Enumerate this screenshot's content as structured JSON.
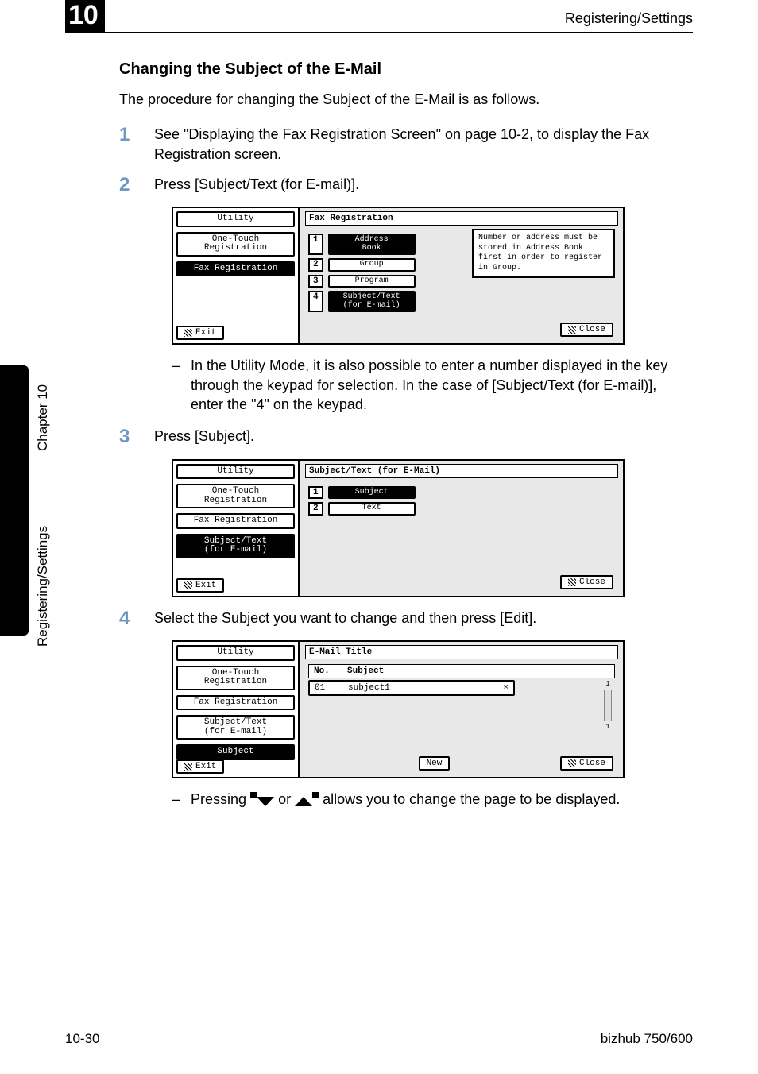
{
  "header": {
    "chapter_num": "10",
    "title": "Registering/Settings"
  },
  "side": {
    "chapter": "Chapter 10",
    "section": "Registering/Settings"
  },
  "footer": {
    "page": "10-30",
    "model": "bizhub 750/600"
  },
  "section_heading": "Changing the Subject of the E-Mail",
  "intro": "The procedure for changing the Subject of the E-Mail is as follows.",
  "steps": {
    "s1": {
      "num": "1",
      "text": "See \"Displaying the Fax Registration Screen\" on page 10-2, to display the Fax Registration screen."
    },
    "s2": {
      "num": "2",
      "text": "Press [Subject/Text (for E-mail)]."
    },
    "s3": {
      "num": "3",
      "text": "Press [Subject]."
    },
    "s4": {
      "num": "4",
      "text": "Select the Subject you want to change and then press [Edit]."
    }
  },
  "note1": "In the Utility Mode, it is also possible to enter a number displayed in the key through the keypad for selection. In the case of [Subject/Text (for E-mail)], enter the \"4\" on the keypad.",
  "note2_a": "Pressing ",
  "note2_b": " or ",
  "note2_c": " allows you to change the page to be displayed.",
  "emu_common": {
    "utility": "Utility",
    "one_touch": "One-Touch\nRegistration",
    "fax_reg": "Fax Registration",
    "subj_text": "Subject/Text\n(for E-mail)",
    "subject": "Subject",
    "exit": "Exit",
    "close": "Close",
    "new": "New"
  },
  "emu1": {
    "title": "Fax Registration",
    "opts": {
      "o1": "Address\nBook",
      "o2": "Group",
      "o3": "Program",
      "o4": "Subject/Text\n(for E-mail)"
    },
    "hint": "Number or address must be stored in Address Book first in order to register in Group."
  },
  "emu2": {
    "title": "Subject/Text (for E-Mail)",
    "opts": {
      "o1": "Subject",
      "o2": "Text"
    }
  },
  "emu3": {
    "title": "E-Mail Title",
    "col_no": "No.",
    "col_subj": "Subject",
    "row_no": "01",
    "row_subj": "subject1",
    "row_flag": "×",
    "scroll_top": "1",
    "scroll_bot": "1"
  }
}
